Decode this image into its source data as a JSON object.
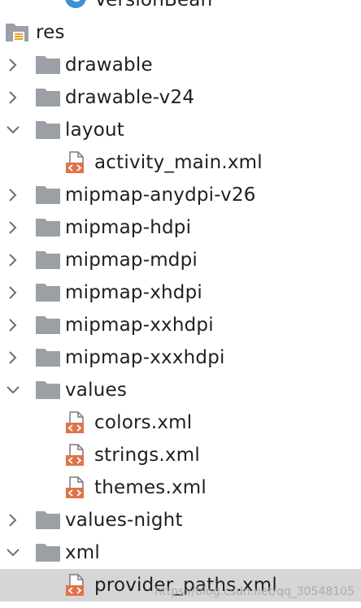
{
  "colors": {
    "folder": "#9aa0a6",
    "xml_badge": "#e0734a",
    "selected_row": "#d6d6d6",
    "class_badge": "#3d8fd6"
  },
  "top_partial": {
    "label": "VersionBean",
    "icon": "class-c-icon",
    "badge_letter": "C"
  },
  "res": {
    "label": "res",
    "icon": "resource-root-icon"
  },
  "rows": [
    {
      "label": "drawable",
      "type": "folder",
      "expanded": false
    },
    {
      "label": "drawable-v24",
      "type": "folder",
      "expanded": false
    },
    {
      "label": "layout",
      "type": "folder",
      "expanded": true
    },
    {
      "label": "activity_main.xml",
      "type": "file"
    },
    {
      "label": "mipmap-anydpi-v26",
      "type": "folder",
      "expanded": false
    },
    {
      "label": "mipmap-hdpi",
      "type": "folder",
      "expanded": false
    },
    {
      "label": "mipmap-mdpi",
      "type": "folder",
      "expanded": false
    },
    {
      "label": "mipmap-xhdpi",
      "type": "folder",
      "expanded": false
    },
    {
      "label": "mipmap-xxhdpi",
      "type": "folder",
      "expanded": false
    },
    {
      "label": "mipmap-xxxhdpi",
      "type": "folder",
      "expanded": false
    },
    {
      "label": "values",
      "type": "folder",
      "expanded": true
    },
    {
      "label": "colors.xml",
      "type": "file"
    },
    {
      "label": "strings.xml",
      "type": "file"
    },
    {
      "label": "themes.xml",
      "type": "file"
    },
    {
      "label": "values-night",
      "type": "folder",
      "expanded": false
    },
    {
      "label": "xml",
      "type": "folder",
      "expanded": true
    },
    {
      "label": "provider_paths.xml",
      "type": "file",
      "selected": true
    }
  ],
  "watermark": "https://blog.csdn.net/qq_30548105"
}
